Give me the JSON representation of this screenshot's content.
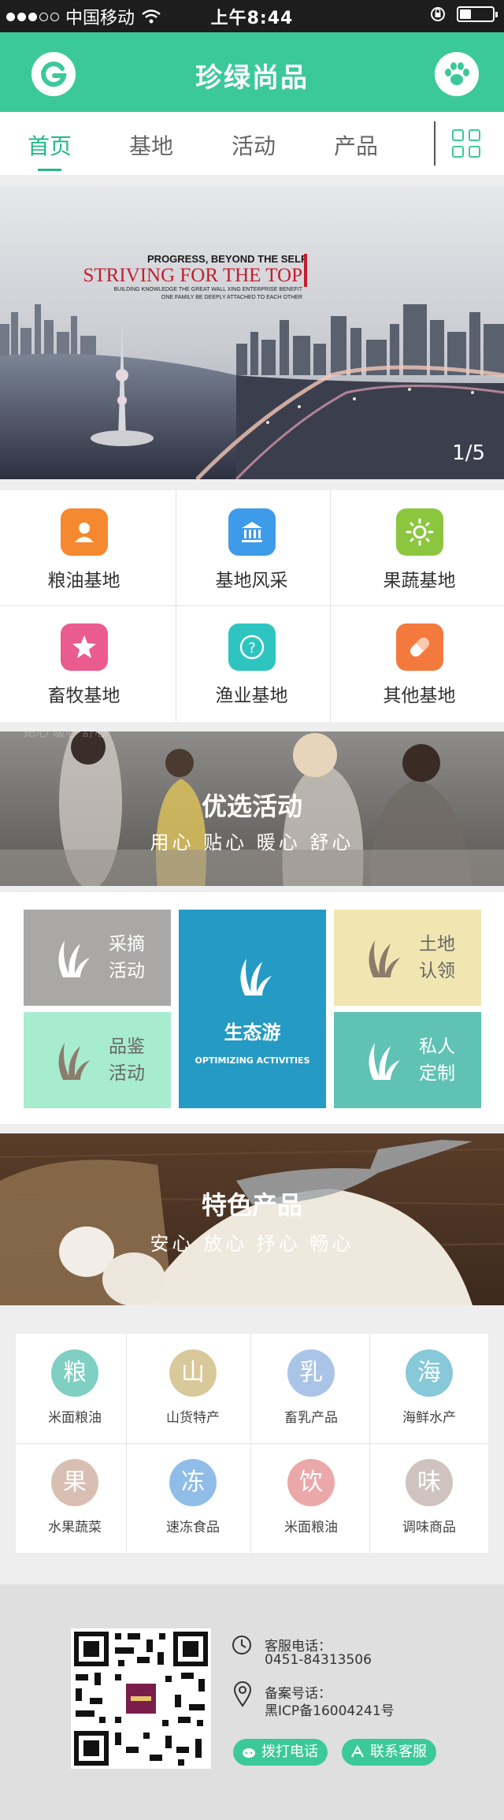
{
  "status_bar": {
    "carrier": "中国移动",
    "time": "上午8:44"
  },
  "header": {
    "title": "珍绿尚品"
  },
  "tabs": [
    {
      "label": "首页"
    },
    {
      "label": "基地"
    },
    {
      "label": "活动"
    },
    {
      "label": "产品"
    }
  ],
  "banner": {
    "line1": "PROGRESS, BEYOND THE SELF",
    "line2": "STRIVING FOR THE TOP",
    "line3": "BUILDING KNOWLEDGE THE GREAT WALL XING ENTERPRISE BENEFIT",
    "line4": "ONE FAMILY BE DEEPLY ATTACHED TO EACH OTHER",
    "pager": "1/5"
  },
  "categories": [
    {
      "label": "粮油基地",
      "icon": "person-icon",
      "color": "#f4892f"
    },
    {
      "label": "基地风采",
      "icon": "bank-icon",
      "color": "#3d9be9"
    },
    {
      "label": "果蔬基地",
      "icon": "sun-icon",
      "color": "#8cc63e"
    },
    {
      "label": "畜牧基地",
      "icon": "star-icon",
      "color": "#ea5b8e"
    },
    {
      "label": "渔业基地",
      "icon": "question-icon",
      "color": "#2ec5c0"
    },
    {
      "label": "其他基地",
      "icon": "pill-icon",
      "color": "#f37a3c"
    }
  ],
  "activities_banner": {
    "title": "优选活动",
    "subtitle": "用心 贴心 暖心 舒心",
    "faint_text": "贴心 暖心 舒心"
  },
  "activities": [
    {
      "label_line1": "采摘",
      "label_line2": "活动",
      "color": "#a9a8a7"
    },
    {
      "label_line1": "生态游",
      "label_line2": "OPTIMIZING ACTIVITIES",
      "color": "#259ac4"
    },
    {
      "label_line1": "土地",
      "label_line2": "认领",
      "color": "#f1e6b1"
    },
    {
      "label_line1": "品鉴",
      "label_line2": "活动",
      "color": "#a8ecd0"
    },
    {
      "label_line1": "私人",
      "label_line2": "定制",
      "color": "#5fc2b4"
    }
  ],
  "products_banner": {
    "title": "特色产品",
    "subtitle": "安心 放心 抒心 畅心"
  },
  "products": [
    {
      "char": "粮",
      "label": "米面粮油",
      "color": "#7fcfc3"
    },
    {
      "char": "山",
      "label": "山货特产",
      "color": "#d9c89a"
    },
    {
      "char": "乳",
      "label": "畜乳产品",
      "color": "#a9c4e6"
    },
    {
      "char": "海",
      "label": "海鲜水产",
      "color": "#87c8d9"
    },
    {
      "char": "果",
      "label": "水果蔬菜",
      "color": "#d9bfb3"
    },
    {
      "char": "冻",
      "label": "速冻食品",
      "color": "#8fbde8"
    },
    {
      "char": "饮",
      "label": "米面粮油",
      "color": "#eba8a8"
    },
    {
      "char": "味",
      "label": "调味商品",
      "color": "#cfc3bf"
    }
  ],
  "footer": {
    "phone_label": "客服电话：",
    "phone": "0451-84313506",
    "icp_label": "备案号话：",
    "icp": "黑ICP备16004241号",
    "call_button": "拨打电话",
    "service_button": "联系客服"
  },
  "colors": {
    "brand": "#3cc99a",
    "active_tab": "#24b88a"
  }
}
